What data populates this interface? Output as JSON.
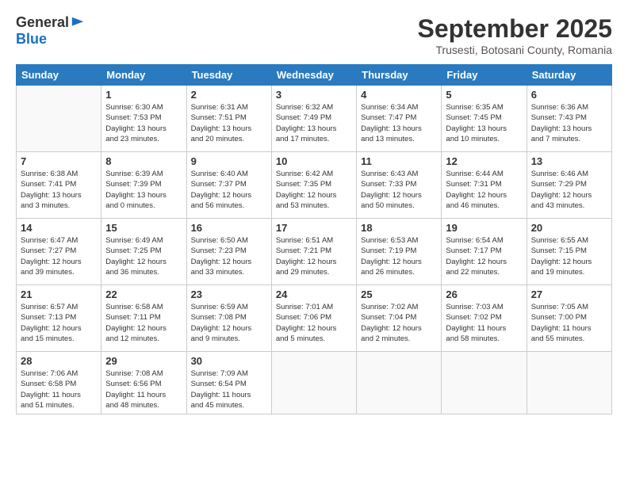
{
  "logo": {
    "general": "General",
    "blue": "Blue"
  },
  "header": {
    "month": "September 2025",
    "location": "Trusesti, Botosani County, Romania"
  },
  "weekdays": [
    "Sunday",
    "Monday",
    "Tuesday",
    "Wednesday",
    "Thursday",
    "Friday",
    "Saturday"
  ],
  "weeks": [
    [
      {
        "day": "",
        "info": ""
      },
      {
        "day": "1",
        "info": "Sunrise: 6:30 AM\nSunset: 7:53 PM\nDaylight: 13 hours\nand 23 minutes."
      },
      {
        "day": "2",
        "info": "Sunrise: 6:31 AM\nSunset: 7:51 PM\nDaylight: 13 hours\nand 20 minutes."
      },
      {
        "day": "3",
        "info": "Sunrise: 6:32 AM\nSunset: 7:49 PM\nDaylight: 13 hours\nand 17 minutes."
      },
      {
        "day": "4",
        "info": "Sunrise: 6:34 AM\nSunset: 7:47 PM\nDaylight: 13 hours\nand 13 minutes."
      },
      {
        "day": "5",
        "info": "Sunrise: 6:35 AM\nSunset: 7:45 PM\nDaylight: 13 hours\nand 10 minutes."
      },
      {
        "day": "6",
        "info": "Sunrise: 6:36 AM\nSunset: 7:43 PM\nDaylight: 13 hours\nand 7 minutes."
      }
    ],
    [
      {
        "day": "7",
        "info": "Sunrise: 6:38 AM\nSunset: 7:41 PM\nDaylight: 13 hours\nand 3 minutes."
      },
      {
        "day": "8",
        "info": "Sunrise: 6:39 AM\nSunset: 7:39 PM\nDaylight: 13 hours\nand 0 minutes."
      },
      {
        "day": "9",
        "info": "Sunrise: 6:40 AM\nSunset: 7:37 PM\nDaylight: 12 hours\nand 56 minutes."
      },
      {
        "day": "10",
        "info": "Sunrise: 6:42 AM\nSunset: 7:35 PM\nDaylight: 12 hours\nand 53 minutes."
      },
      {
        "day": "11",
        "info": "Sunrise: 6:43 AM\nSunset: 7:33 PM\nDaylight: 12 hours\nand 50 minutes."
      },
      {
        "day": "12",
        "info": "Sunrise: 6:44 AM\nSunset: 7:31 PM\nDaylight: 12 hours\nand 46 minutes."
      },
      {
        "day": "13",
        "info": "Sunrise: 6:46 AM\nSunset: 7:29 PM\nDaylight: 12 hours\nand 43 minutes."
      }
    ],
    [
      {
        "day": "14",
        "info": "Sunrise: 6:47 AM\nSunset: 7:27 PM\nDaylight: 12 hours\nand 39 minutes."
      },
      {
        "day": "15",
        "info": "Sunrise: 6:49 AM\nSunset: 7:25 PM\nDaylight: 12 hours\nand 36 minutes."
      },
      {
        "day": "16",
        "info": "Sunrise: 6:50 AM\nSunset: 7:23 PM\nDaylight: 12 hours\nand 33 minutes."
      },
      {
        "day": "17",
        "info": "Sunrise: 6:51 AM\nSunset: 7:21 PM\nDaylight: 12 hours\nand 29 minutes."
      },
      {
        "day": "18",
        "info": "Sunrise: 6:53 AM\nSunset: 7:19 PM\nDaylight: 12 hours\nand 26 minutes."
      },
      {
        "day": "19",
        "info": "Sunrise: 6:54 AM\nSunset: 7:17 PM\nDaylight: 12 hours\nand 22 minutes."
      },
      {
        "day": "20",
        "info": "Sunrise: 6:55 AM\nSunset: 7:15 PM\nDaylight: 12 hours\nand 19 minutes."
      }
    ],
    [
      {
        "day": "21",
        "info": "Sunrise: 6:57 AM\nSunset: 7:13 PM\nDaylight: 12 hours\nand 15 minutes."
      },
      {
        "day": "22",
        "info": "Sunrise: 6:58 AM\nSunset: 7:11 PM\nDaylight: 12 hours\nand 12 minutes."
      },
      {
        "day": "23",
        "info": "Sunrise: 6:59 AM\nSunset: 7:08 PM\nDaylight: 12 hours\nand 9 minutes."
      },
      {
        "day": "24",
        "info": "Sunrise: 7:01 AM\nSunset: 7:06 PM\nDaylight: 12 hours\nand 5 minutes."
      },
      {
        "day": "25",
        "info": "Sunrise: 7:02 AM\nSunset: 7:04 PM\nDaylight: 12 hours\nand 2 minutes."
      },
      {
        "day": "26",
        "info": "Sunrise: 7:03 AM\nSunset: 7:02 PM\nDaylight: 11 hours\nand 58 minutes."
      },
      {
        "day": "27",
        "info": "Sunrise: 7:05 AM\nSunset: 7:00 PM\nDaylight: 11 hours\nand 55 minutes."
      }
    ],
    [
      {
        "day": "28",
        "info": "Sunrise: 7:06 AM\nSunset: 6:58 PM\nDaylight: 11 hours\nand 51 minutes."
      },
      {
        "day": "29",
        "info": "Sunrise: 7:08 AM\nSunset: 6:56 PM\nDaylight: 11 hours\nand 48 minutes."
      },
      {
        "day": "30",
        "info": "Sunrise: 7:09 AM\nSunset: 6:54 PM\nDaylight: 11 hours\nand 45 minutes."
      },
      {
        "day": "",
        "info": ""
      },
      {
        "day": "",
        "info": ""
      },
      {
        "day": "",
        "info": ""
      },
      {
        "day": "",
        "info": ""
      }
    ]
  ]
}
